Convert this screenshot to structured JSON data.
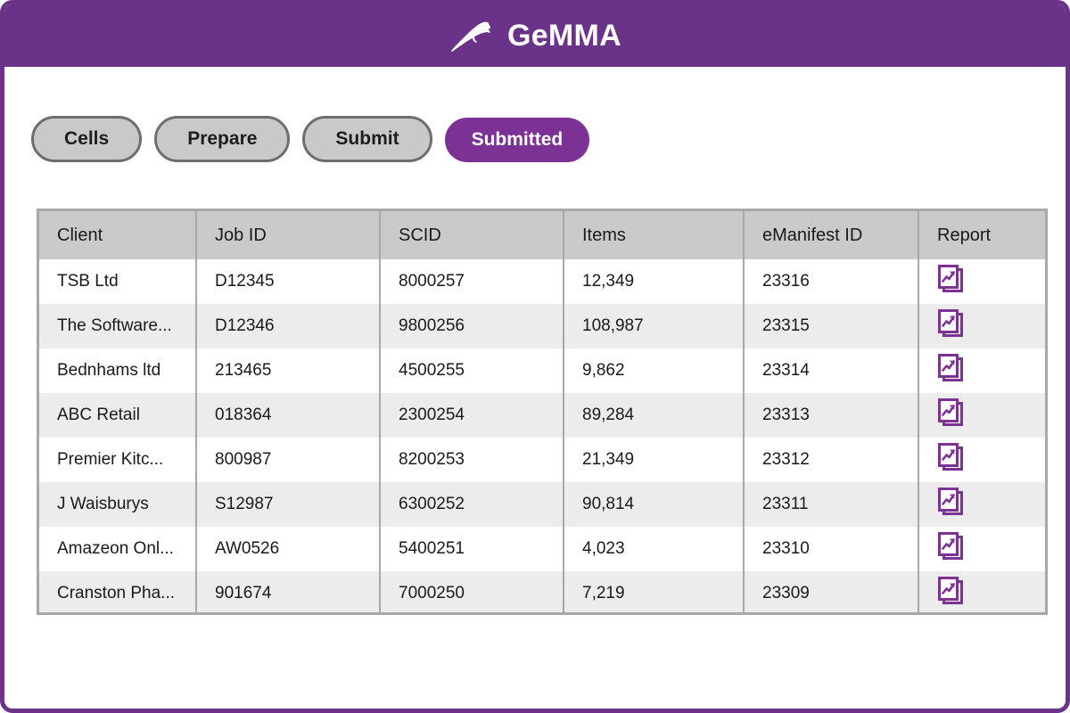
{
  "app": {
    "title": "GeMMA",
    "logo_icon": "bird-logo-icon",
    "brand_color": "#6B3289",
    "accent_color": "#7B3294"
  },
  "tabs": [
    {
      "label": "Cells",
      "active": false
    },
    {
      "label": "Prepare",
      "active": false
    },
    {
      "label": "Submit",
      "active": false
    },
    {
      "label": "Submitted",
      "active": true
    }
  ],
  "table": {
    "columns": [
      "Client",
      "Job ID",
      "SCID",
      "Items",
      "eManifest ID",
      "Report"
    ],
    "report_icon": "report-document-chart-icon",
    "rows": [
      {
        "client": "TSB Ltd",
        "job_id": "D12345",
        "scid": "8000257",
        "items": "12,349",
        "emanifest_id": "23316"
      },
      {
        "client": "The Software...",
        "job_id": "D12346",
        "scid": "9800256",
        "items": "108,987",
        "emanifest_id": "23315"
      },
      {
        "client": "Bednhams ltd",
        "job_id": "213465",
        "scid": "4500255",
        "items": "9,862",
        "emanifest_id": "23314"
      },
      {
        "client": "ABC Retail",
        "job_id": "018364",
        "scid": "2300254",
        "items": "89,284",
        "emanifest_id": "23313"
      },
      {
        "client": "Premier Kitc...",
        "job_id": "800987",
        "scid": "8200253",
        "items": "21,349",
        "emanifest_id": "23312"
      },
      {
        "client": "J Waisburys",
        "job_id": "S12987",
        "scid": "6300252",
        "items": "90,814",
        "emanifest_id": "23311"
      },
      {
        "client": "Amazeon Onl...",
        "job_id": "AW0526",
        "scid": "5400251",
        "items": "4,023",
        "emanifest_id": "23310"
      },
      {
        "client": "Cranston Pha...",
        "job_id": "901674",
        "scid": "7000250",
        "items": "7,219",
        "emanifest_id": "23309"
      }
    ]
  }
}
